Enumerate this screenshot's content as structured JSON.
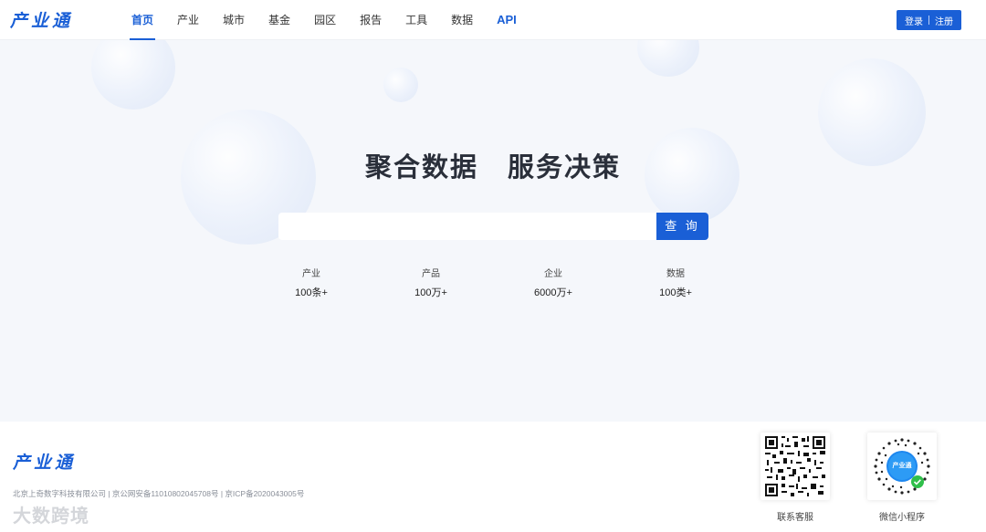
{
  "header": {
    "logo": "产业通",
    "nav": [
      "首页",
      "产业",
      "城市",
      "基金",
      "园区",
      "报告",
      "工具",
      "数据",
      "API"
    ],
    "active_nav": "首页",
    "login": "登录",
    "register": "注册"
  },
  "hero": {
    "slogan": "聚合数据 服务决策",
    "search_placeholder": "",
    "search_button": "查 询",
    "stats": [
      {
        "label": "产业",
        "value": "100条+"
      },
      {
        "label": "产品",
        "value": "100万+"
      },
      {
        "label": "企业",
        "value": "6000万+"
      },
      {
        "label": "数据",
        "value": "100类+"
      }
    ]
  },
  "footer": {
    "logo": "产业通",
    "company_info": "北京上奇数字科技有限公司 | 京公网安备11010802045708号 | 京ICP备2020043005号",
    "watermark": "大数跨境",
    "qr_service_label": "联系客服",
    "qr_miniprogram_label": "微信小程序",
    "miniprogram_badge": "产业通"
  },
  "colors": {
    "accent": "#1a5fd6",
    "background": "#f5f7fb"
  }
}
